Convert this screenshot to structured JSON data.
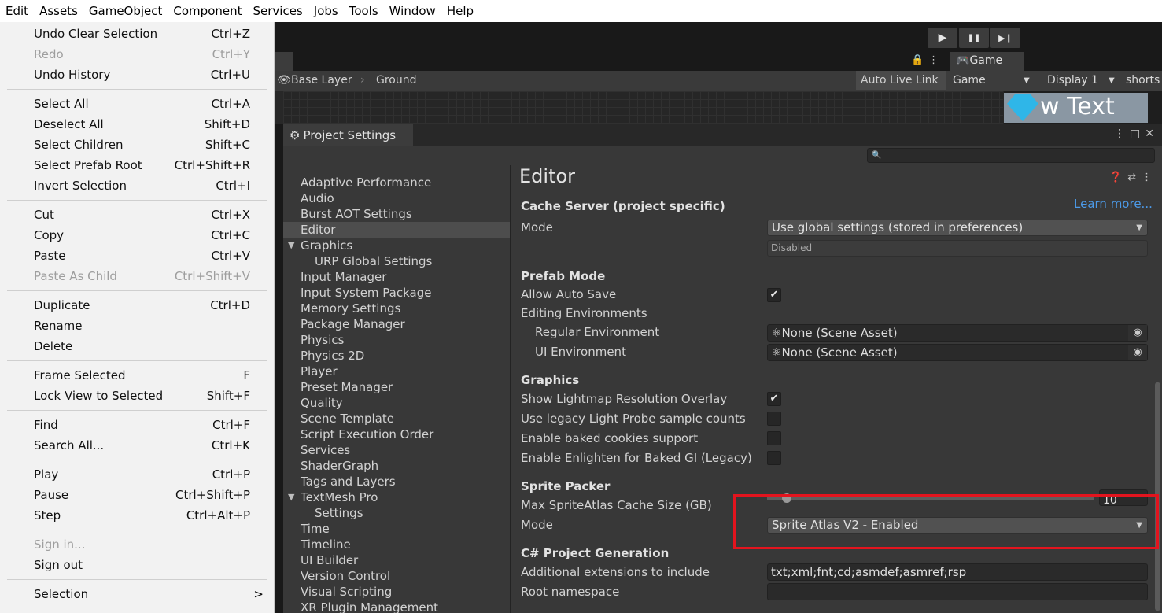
{
  "menubar": [
    "Edit",
    "Assets",
    "GameObject",
    "Component",
    "Services",
    "Jobs",
    "Tools",
    "Window",
    "Help"
  ],
  "toolbar": {
    "play": "▶",
    "pause": "❚❚",
    "step": "▶❙"
  },
  "scene": {
    "breadcrumbs": [
      "Base Layer",
      "Ground"
    ],
    "auto_live_link": "Auto Live Link",
    "game_tab": "Game",
    "game_select": "Game",
    "display_select": "Display 1",
    "shortcut_label": "shorts",
    "new_text": "w Text"
  },
  "project_settings": {
    "tab_title": "Project Settings",
    "search_placeholder": "",
    "sidebar": [
      {
        "label": "Adaptive Performance",
        "indent": 0
      },
      {
        "label": "Audio",
        "indent": 0
      },
      {
        "label": "Burst AOT Settings",
        "indent": 0
      },
      {
        "label": "Editor",
        "indent": 0,
        "selected": true
      },
      {
        "label": "Graphics",
        "indent": 0,
        "expandable": true
      },
      {
        "label": "URP Global Settings",
        "indent": 1
      },
      {
        "label": "Input Manager",
        "indent": 0
      },
      {
        "label": "Input System Package",
        "indent": 0
      },
      {
        "label": "Memory Settings",
        "indent": 0
      },
      {
        "label": "Package Manager",
        "indent": 0
      },
      {
        "label": "Physics",
        "indent": 0
      },
      {
        "label": "Physics 2D",
        "indent": 0
      },
      {
        "label": "Player",
        "indent": 0
      },
      {
        "label": "Preset Manager",
        "indent": 0
      },
      {
        "label": "Quality",
        "indent": 0
      },
      {
        "label": "Scene Template",
        "indent": 0
      },
      {
        "label": "Script Execution Order",
        "indent": 0
      },
      {
        "label": "Services",
        "indent": 0
      },
      {
        "label": "ShaderGraph",
        "indent": 0
      },
      {
        "label": "Tags and Layers",
        "indent": 0
      },
      {
        "label": "TextMesh Pro",
        "indent": 0,
        "expandable": true
      },
      {
        "label": "Settings",
        "indent": 1
      },
      {
        "label": "Time",
        "indent": 0
      },
      {
        "label": "Timeline",
        "indent": 0
      },
      {
        "label": "UI Builder",
        "indent": 0
      },
      {
        "label": "Version Control",
        "indent": 0
      },
      {
        "label": "Visual Scripting",
        "indent": 0
      },
      {
        "label": "XR Plugin Management",
        "indent": 0
      }
    ],
    "editor": {
      "title": "Editor",
      "learn_more": "Learn more...",
      "cache_server_header": "Cache Server (project specific)",
      "cache_mode_label": "Mode",
      "cache_mode_value": "Use global settings (stored in preferences)",
      "cache_status": "Disabled",
      "prefab_header": "Prefab Mode",
      "allow_auto_save_label": "Allow Auto Save",
      "allow_auto_save": true,
      "editing_env_label": "Editing Environments",
      "regular_env_label": "Regular Environment",
      "regular_env_value": "None (Scene Asset)",
      "ui_env_label": "UI Environment",
      "ui_env_value": "None (Scene Asset)",
      "graphics_header": "Graphics",
      "lightmap_overlay_label": "Show Lightmap Resolution Overlay",
      "lightmap_overlay": true,
      "legacy_probe_label": "Use legacy Light Probe sample counts",
      "legacy_probe": false,
      "baked_cookies_label": "Enable baked cookies support",
      "baked_cookies": false,
      "enlighten_label": "Enable Enlighten for Baked GI (Legacy)",
      "enlighten": false,
      "sprite_packer_header": "Sprite Packer",
      "atlas_cache_label": "Max SpriteAtlas Cache Size (GB)",
      "atlas_cache_value": "10",
      "sprite_mode_label": "Mode",
      "sprite_mode_value": "Sprite Atlas V2 - Enabled",
      "csharp_header": "C# Project Generation",
      "extensions_label": "Additional extensions to include",
      "extensions_value": "txt;xml;fnt;cd;asmdef;asmref;rsp",
      "root_namespace_label": "Root namespace",
      "root_namespace_value": ""
    }
  },
  "edit_menu": [
    {
      "label": "Undo Clear Selection",
      "shortcut": "Ctrl+Z"
    },
    {
      "label": "Redo",
      "shortcut": "Ctrl+Y",
      "disabled": true
    },
    {
      "label": "Undo History",
      "shortcut": "Ctrl+U"
    },
    {
      "sep": true
    },
    {
      "label": "Select All",
      "shortcut": "Ctrl+A"
    },
    {
      "label": "Deselect All",
      "shortcut": "Shift+D"
    },
    {
      "label": "Select Children",
      "shortcut": "Shift+C"
    },
    {
      "label": "Select Prefab Root",
      "shortcut": "Ctrl+Shift+R"
    },
    {
      "label": "Invert Selection",
      "shortcut": "Ctrl+I"
    },
    {
      "sep": true
    },
    {
      "label": "Cut",
      "shortcut": "Ctrl+X"
    },
    {
      "label": "Copy",
      "shortcut": "Ctrl+C"
    },
    {
      "label": "Paste",
      "shortcut": "Ctrl+V"
    },
    {
      "label": "Paste As Child",
      "shortcut": "Ctrl+Shift+V",
      "disabled": true
    },
    {
      "sep": true
    },
    {
      "label": "Duplicate",
      "shortcut": "Ctrl+D"
    },
    {
      "label": "Rename",
      "shortcut": ""
    },
    {
      "label": "Delete",
      "shortcut": ""
    },
    {
      "sep": true
    },
    {
      "label": "Frame Selected",
      "shortcut": "F"
    },
    {
      "label": "Lock View to Selected",
      "shortcut": "Shift+F"
    },
    {
      "sep": true
    },
    {
      "label": "Find",
      "shortcut": "Ctrl+F"
    },
    {
      "label": "Search All...",
      "shortcut": "Ctrl+K"
    },
    {
      "sep": true
    },
    {
      "label": "Play",
      "shortcut": "Ctrl+P"
    },
    {
      "label": "Pause",
      "shortcut": "Ctrl+Shift+P"
    },
    {
      "label": "Step",
      "shortcut": "Ctrl+Alt+P"
    },
    {
      "sep": true
    },
    {
      "label": "Sign in...",
      "shortcut": "",
      "disabled": true
    },
    {
      "label": "Sign out",
      "shortcut": ""
    },
    {
      "sep": true
    },
    {
      "label": "Selection",
      "shortcut": ">"
    }
  ],
  "colors": {
    "highlight_box": "#e3141e",
    "link": "#4c9ae8"
  }
}
